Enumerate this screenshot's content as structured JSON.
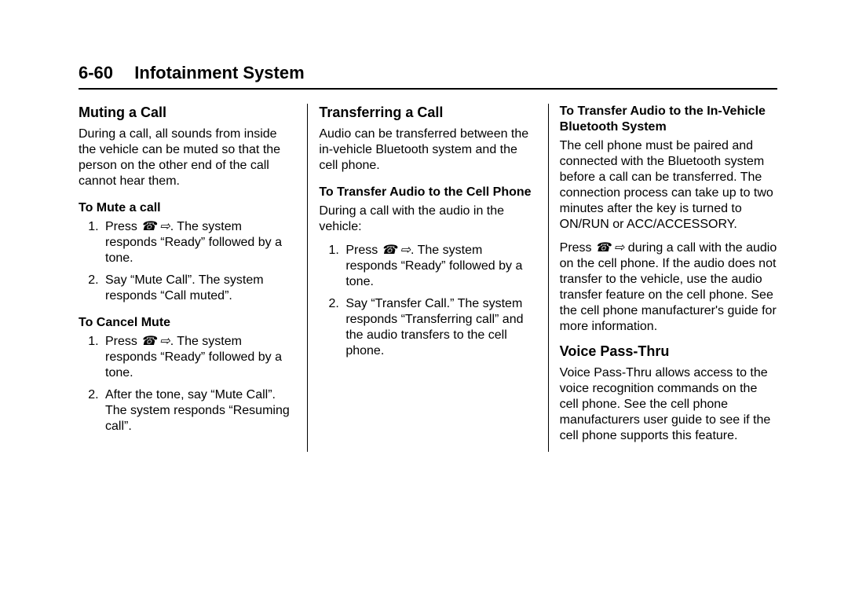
{
  "header": {
    "page_number": "6-60",
    "title": "Infotainment System"
  },
  "col1": {
    "h1": "Muting a Call",
    "p1": "During a call, all sounds from inside the vehicle can be muted so that the person on the other end of the call cannot hear them.",
    "sub1": "To Mute a call",
    "s1_li1_a": "Press ",
    "s1_li1_b": ". The system responds “Ready” followed by a tone.",
    "s1_li2": "Say “Mute Call”. The system responds “Call muted”.",
    "sub2": "To Cancel Mute",
    "s2_li1_a": "Press ",
    "s2_li1_b": ". The system responds “Ready” followed by a tone.",
    "s2_li2": "After the tone, say “Mute Call”. The system responds “Resuming call”."
  },
  "col2": {
    "h1": "Transferring a Call",
    "p1": "Audio can be transferred between the in-vehicle Bluetooth system and the cell phone.",
    "sub1": "To Transfer Audio to the Cell Phone",
    "p2": "During a call with the audio in the vehicle:",
    "s1_li1_a": "Press ",
    "s1_li1_b": ". The system responds “Ready” followed by a tone.",
    "s1_li2": "Say “Transfer Call.” The system responds “Transferring call” and the audio transfers to the cell phone."
  },
  "col3": {
    "sub1": "To Transfer Audio to the In-Vehicle Bluetooth System",
    "p1": "The cell phone must be paired and connected with the Bluetooth system before a call can be transferred. The connection process can take up to two minutes after the key is turned to ON/RUN or ACC/ACCESSORY.",
    "p2_a": "Press ",
    "p2_b": " during a call with the audio on the cell phone. If the audio does not transfer to the vehicle, use the audio transfer feature on the cell phone. See the cell phone manufacturer's guide for more information.",
    "h2": "Voice Pass-Thru",
    "p3": "Voice Pass-Thru allows access to the voice recognition commands on the cell phone. See the cell phone manufacturers user guide to see if the cell phone supports this feature."
  },
  "icon_text": "☎ ⇨"
}
